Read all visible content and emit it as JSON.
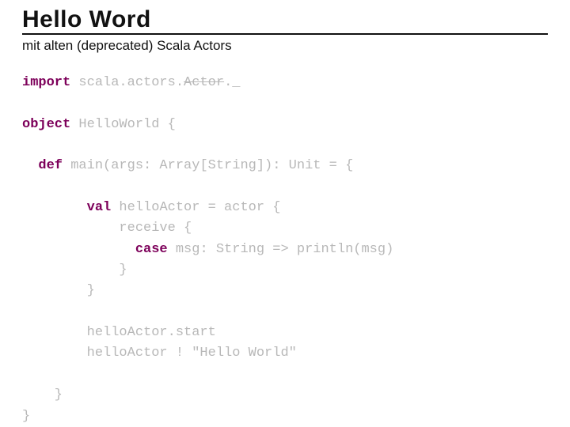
{
  "title": "Hello Word",
  "subtitle": "mit alten (deprecated) Scala Actors",
  "code": {
    "kw_import": "import",
    "import_rest_a": " scala.actors.",
    "import_actor": "Actor",
    "import_rest_b": "._",
    "kw_object": "object",
    "object_rest": " HelloWorld {",
    "kw_def": "def",
    "def_rest": " main(args: Array[String]): Unit = {",
    "kw_val": "val",
    "val_rest": " helloActor = actor {",
    "receive_line": "            receive {",
    "kw_case": "case",
    "case_rest": " msg: String => println(msg)",
    "close_brace1": "            }",
    "close_brace2": "        }",
    "start_line": "        helloActor.start",
    "send_line": "        helloActor ! \"Hello World\"",
    "close_brace3": "    }",
    "close_brace4": "}"
  }
}
